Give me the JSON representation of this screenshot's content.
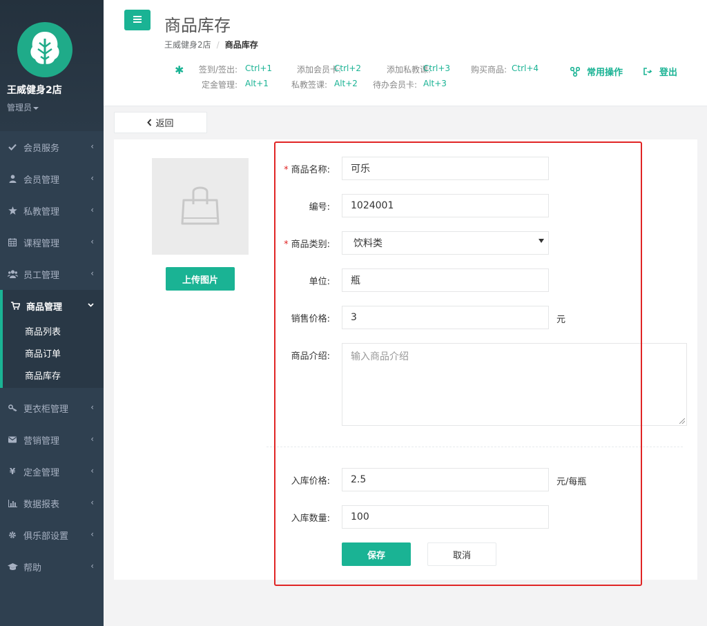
{
  "sidebar": {
    "shop_name": "王威健身2店",
    "role": "管理员",
    "items": [
      {
        "label": "会员服务",
        "icon": "check-icon"
      },
      {
        "label": "会员管理",
        "icon": "user-icon"
      },
      {
        "label": "私教管理",
        "icon": "star-icon"
      },
      {
        "label": "课程管理",
        "icon": "calendar-icon"
      },
      {
        "label": "员工管理",
        "icon": "users-icon"
      },
      {
        "label": "商品管理",
        "icon": "cart-icon"
      },
      {
        "label": "更衣柜管理",
        "icon": "key-icon"
      },
      {
        "label": "营销管理",
        "icon": "envelope-icon"
      },
      {
        "label": "定金管理",
        "icon": "yen-icon"
      },
      {
        "label": "数据报表",
        "icon": "bar-chart-icon"
      },
      {
        "label": "俱乐部设置",
        "icon": "gear-icon"
      },
      {
        "label": "帮助",
        "icon": "graduation-cap-icon"
      }
    ],
    "sub_items": [
      "商品列表",
      "商品订单",
      "商品库存"
    ]
  },
  "header": {
    "title": "商品库存",
    "breadcrumb": [
      "王威健身2店",
      "商品库存"
    ],
    "shortcuts": {
      "row1": [
        {
          "label": "签到/签出:",
          "key": "Ctrl+1"
        },
        {
          "label": "添加会员卡:",
          "key": "Ctrl+2"
        },
        {
          "label": "添加私教课:",
          "key": "Ctrl+3"
        },
        {
          "label": "购买商品:",
          "key": "Ctrl+4"
        }
      ],
      "row2": [
        {
          "label": "定金管理:",
          "key": "Alt+1"
        },
        {
          "label": "私教签课:",
          "key": "Alt+2"
        },
        {
          "label": "待办会员卡:",
          "key": "Alt+3"
        }
      ]
    },
    "common_ops": "常用操作",
    "logout": "登出"
  },
  "content": {
    "back": "返回",
    "upload": "上传图片",
    "form": {
      "name_label": "商品名称:",
      "name_value": "可乐",
      "code_label": "编号:",
      "code_value": "1024001",
      "category_label": "商品类别:",
      "category_value": "饮料类",
      "unit_label": "单位:",
      "unit_value": "瓶",
      "price_label": "销售价格:",
      "price_value": "3",
      "price_unit": "元",
      "intro_label": "商品介绍:",
      "intro_placeholder": "输入商品介绍",
      "in_price_label": "入库价格:",
      "in_price_value": "2.5",
      "in_price_unit": "元/每瓶",
      "in_qty_label": "入库数量:",
      "in_qty_value": "100",
      "save": "保存",
      "cancel": "取消"
    }
  },
  "colors": {
    "accent": "#1ab394",
    "sidebar_bg": "#2f4050",
    "highlight_border": "#e02424"
  }
}
